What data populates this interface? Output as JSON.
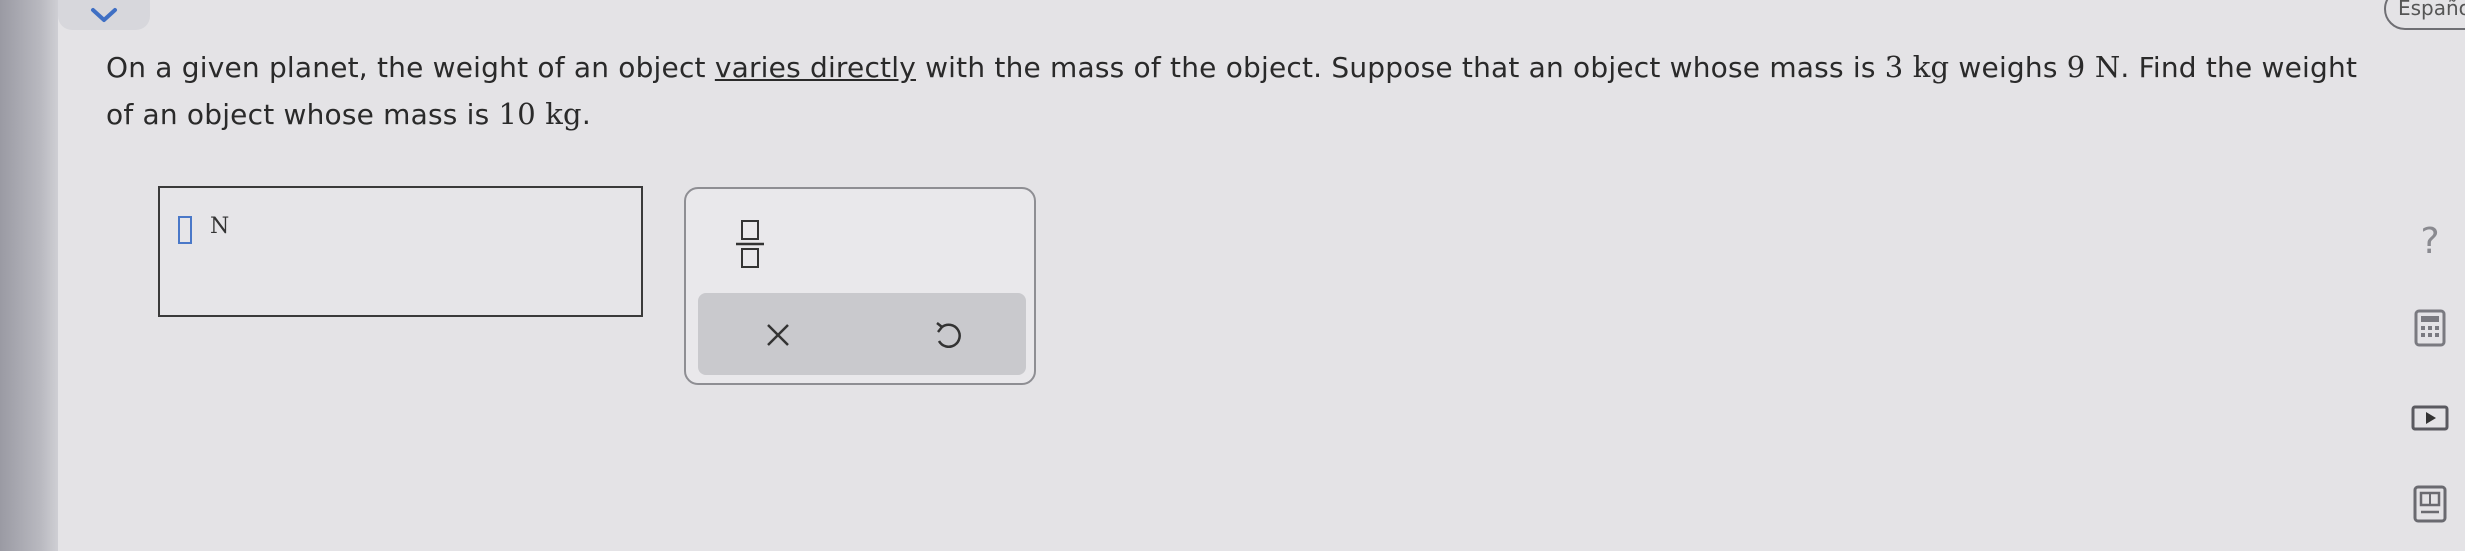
{
  "question": {
    "part1": "On a given planet, the weight of an object ",
    "link": "varies directly",
    "part2": " with the mass of the object. Suppose that an object whose mass is ",
    "mass_known": "3 kg",
    "part3": " weighs ",
    "weight_known": "9 N",
    "part4": ". Find the weight of an object whose mass is ",
    "mass_target": "10 kg",
    "part5": "."
  },
  "answer": {
    "value": "",
    "unit": "N"
  },
  "toolbar": {
    "language": "Español"
  },
  "icons": {
    "collapse": "chevron-down-icon",
    "fraction": "fraction-icon",
    "clear": "close-icon",
    "undo": "undo-icon",
    "help": "help-icon",
    "calculator": "calculator-icon",
    "video": "play-video-icon",
    "textbook": "textbook-icon"
  },
  "colors": {
    "accent": "#4a78c8",
    "background": "#e4e3e6"
  }
}
